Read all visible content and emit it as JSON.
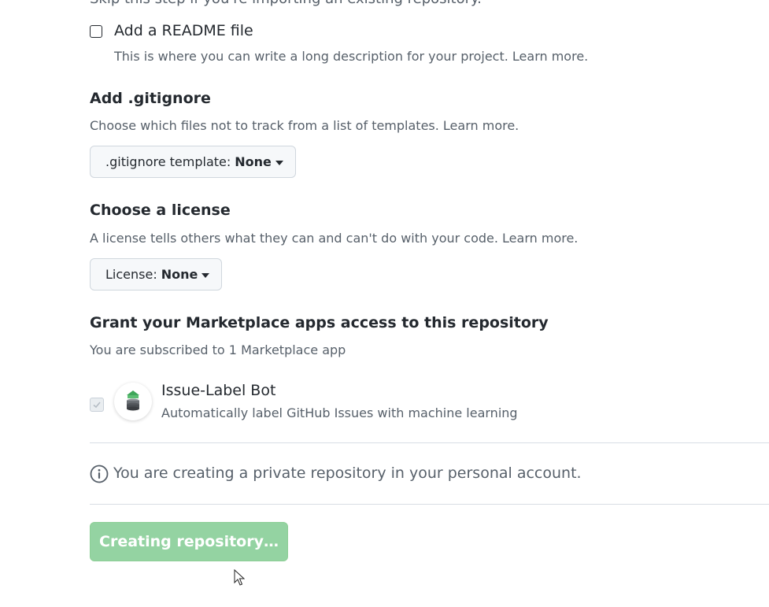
{
  "intro": {
    "cut_text": "Skip this step if you're importing an existing repository."
  },
  "readme": {
    "label": "Add a README file",
    "description": "This is where you can write a long description for your project. Learn more.",
    "checked": false
  },
  "gitignore": {
    "title": "Add .gitignore",
    "description": "Choose which files not to track from a list of templates. Learn more.",
    "button_label": ".gitignore template:",
    "button_value": "None"
  },
  "license": {
    "title": "Choose a license",
    "description": "A license tells others what they can and can't do with your code. Learn more.",
    "button_label": "License:",
    "button_value": "None"
  },
  "marketplace": {
    "title": "Grant your Marketplace apps access to this repository",
    "subtitle": "You are subscribed to 1 Marketplace app",
    "apps": [
      {
        "name": "Issue-Label Bot",
        "description": "Automatically label GitHub Issues with machine learning",
        "checked": true,
        "icon": "robot-stack-icon"
      }
    ]
  },
  "notice": {
    "icon": "info-icon",
    "text": "You are creating a private repository in your personal account."
  },
  "submit": {
    "label": "Creating repository…",
    "state": "disabled"
  },
  "colors": {
    "button_green_disabled": "#94d3a2",
    "muted_text": "#57606a",
    "primary_text": "#24292f",
    "border": "#d0d7de"
  }
}
